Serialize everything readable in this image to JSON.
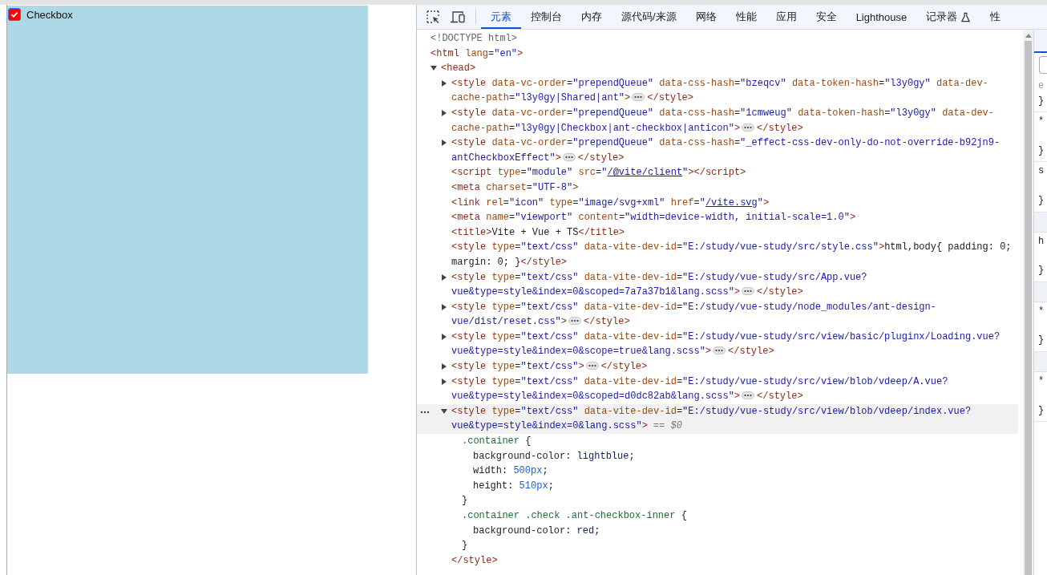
{
  "page": {
    "checkbox": {
      "label": "Checkbox",
      "checked": true
    }
  },
  "devtools": {
    "tabs": [
      {
        "label": "元素",
        "selected": true,
        "experimental": false
      },
      {
        "label": "控制台",
        "selected": false,
        "experimental": false
      },
      {
        "label": "内存",
        "selected": false,
        "experimental": false
      },
      {
        "label": "源代码/来源",
        "selected": false,
        "experimental": false
      },
      {
        "label": "网络",
        "selected": false,
        "experimental": false
      },
      {
        "label": "性能",
        "selected": false,
        "experimental": false
      },
      {
        "label": "应用",
        "selected": false,
        "experimental": false
      },
      {
        "label": "安全",
        "selected": false,
        "experimental": false
      },
      {
        "label": "Lighthouse",
        "selected": false,
        "experimental": false
      },
      {
        "label": "记录器",
        "selected": false,
        "experimental": true
      },
      {
        "label": "性",
        "selected": false,
        "experimental": false
      }
    ],
    "tree": [
      {
        "kind": "doctype",
        "open": "<!DOCTYPE html>",
        "selected": false
      },
      {
        "kind": "element",
        "open": "<html lang=\"en\">",
        "selected": false,
        "children": [
          {
            "kind": "element",
            "open": "<head>",
            "selected": false,
            "expanded": true,
            "children": [
              {
                "kind": "element",
                "open": "<style data-vc-order=\"prependQueue\" data-css-hash=\"bzeqcv\" data-token-hash=\"l3y0gy\" data-dev-cache-path=\"l3y0gy|Shared|ant\">",
                "selected": false,
                "expanded": false,
                "close": "</style>"
              },
              {
                "kind": "element",
                "open": "<style data-vc-order=\"prependQueue\" data-css-hash=\"1cmweug\" data-token-hash=\"l3y0gy\" data-dev-cache-path=\"l3y0gy|Checkbox|ant-checkbox|anticon\">",
                "selected": false,
                "expanded": false,
                "close": "</style>"
              },
              {
                "kind": "element",
                "open": "<style data-vc-order=\"prependQueue\" data-css-hash=\"_effect-css-dev-only-do-not-override-b92jn9-antCheckboxEffect\">",
                "selected": false,
                "expanded": false,
                "close": "</style>"
              },
              {
                "kind": "element",
                "open": "<script type=\"module\" src=\"/@vite/client\">",
                "selected": false,
                "link": true,
                "close": "</script>"
              },
              {
                "kind": "element",
                "open": "<meta charset=\"UTF-8\">",
                "selected": false
              },
              {
                "kind": "element",
                "open": "<link rel=\"icon\" type=\"image/svg+xml\" href=\"/vite.svg\">",
                "selected": false,
                "link": true
              },
              {
                "kind": "element",
                "open": "<meta name=\"viewport\" content=\"width=device-width, initial-scale=1.0\">",
                "selected": false
              },
              {
                "kind": "element",
                "open": "<title>",
                "selected": false,
                "text": "Vite + Vue + TS",
                "close": "</title>"
              },
              {
                "kind": "element",
                "open": "<style type=\"text/css\" data-vite-dev-id=\"E:/study/vue-study/src/style.css\">",
                "selected": false,
                "text": "html,body{ padding: 0; margin: 0; }",
                "close": "</style>"
              },
              {
                "kind": "element",
                "open": "<style type=\"text/css\" data-vite-dev-id=\"E:/study/vue-study/src/App.vue?vue&type=style&index=0&scoped=7a7a37b1&lang.scss\">",
                "selected": false,
                "expanded": false,
                "close": "</style>"
              },
              {
                "kind": "element",
                "open": "<style type=\"text/css\" data-vite-dev-id=\"E:/study/vue-study/node_modules/ant-design-vue/dist/reset.css\">",
                "selected": false,
                "expanded": false,
                "close": "</style>"
              },
              {
                "kind": "element",
                "open": "<style type=\"text/css\" data-vite-dev-id=\"E:/study/vue-study/src/view/basic/pluginx/Loading.vue?vue&type=style&index=0&scope=true&lang.scss\">",
                "selected": false,
                "expanded": false,
                "close": "</style>"
              },
              {
                "kind": "element",
                "open": "<style type=\"text/css\">",
                "selected": false,
                "expanded": false,
                "close": "</style>"
              },
              {
                "kind": "element",
                "open": "<style type=\"text/css\" data-vite-dev-id=\"E:/study/vue-study/src/view/blob/vdeep/A.vue?vue&type=style&index=0&scoped=d0dc82ab&lang.scss\">",
                "selected": false,
                "expanded": false,
                "close": "</style>"
              },
              {
                "kind": "element",
                "open": "<style type=\"text/css\" data-vite-dev-id=\"E:/study/vue-study/src/view/blob/vdeep/index.vue?vue&type=style&index=0&lang.scss\">",
                "selected": true,
                "expanded": true,
                "marker": "== $0",
                "close": "</style>",
                "css": [
                  {
                    "selector": ".container {",
                    "declarations": [
                      "background-color: lightblue;",
                      "width: 500px;",
                      "height: 510px;"
                    ],
                    "close": "}"
                  },
                  {
                    "selector": ".container .check .ant-checkbox-inner {",
                    "declarations": [
                      "background-color: red;"
                    ],
                    "close": "}"
                  }
                ]
              }
            ]
          }
        ]
      }
    ],
    "styles_pane": {
      "rules": [
        {
          "start": "e",
          "end": "}",
          "section": false
        },
        {
          "start": "*",
          "end": "}",
          "section": false
        },
        {
          "start": "s",
          "end": "}",
          "section": false
        },
        {
          "start": "h",
          "end": "}",
          "section": true
        },
        {
          "start": "*",
          "end": "}",
          "section": true
        },
        {
          "start": "*",
          "end": "}",
          "section": true
        }
      ]
    }
  }
}
